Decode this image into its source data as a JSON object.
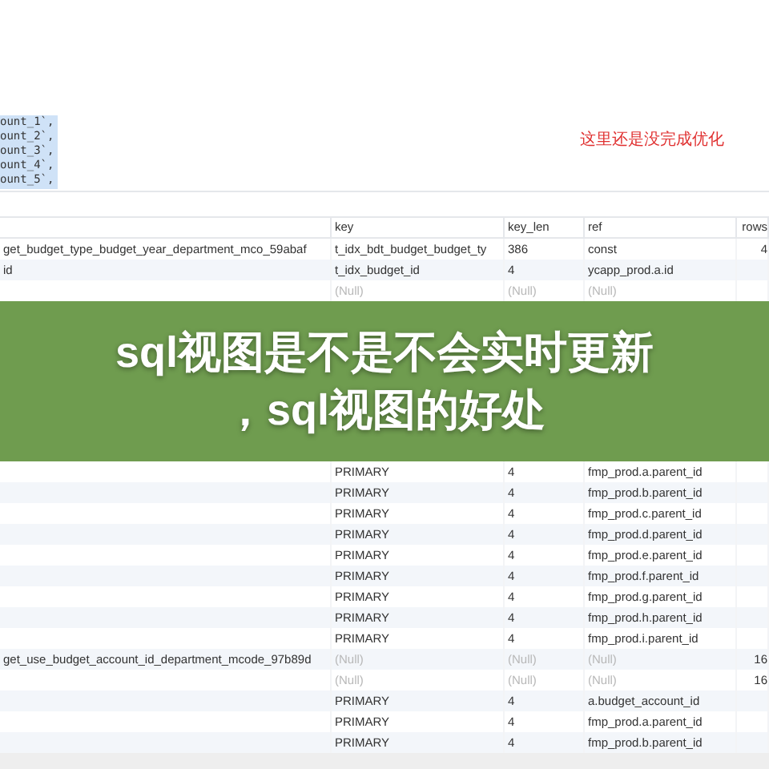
{
  "code_lines": [
    "ount_1`,",
    "ount_2`,",
    "ount_3`,",
    "ount_4`,",
    "ount_5`,"
  ],
  "annotation": "这里还是没完成优化",
  "table": {
    "columns": [
      "",
      "key",
      "key_len",
      "ref",
      "rows"
    ],
    "rows_top": [
      {
        "cells": [
          "get_budget_type_budget_year_department_mco_59abaf",
          "t_idx_bdt_budget_budget_ty",
          "386",
          "const",
          "4"
        ]
      },
      {
        "cells": [
          "id",
          "t_idx_budget_id",
          "4",
          "ycapp_prod.a.id",
          ""
        ]
      },
      {
        "cells": [
          "",
          "(Null)",
          "(Null)",
          "(Null)",
          ""
        ]
      }
    ],
    "rows_bottom": [
      {
        "cells": [
          "",
          "PRIMARY",
          "4",
          "fmp_prod.a.parent_id",
          ""
        ]
      },
      {
        "cells": [
          "",
          "PRIMARY",
          "4",
          "fmp_prod.b.parent_id",
          ""
        ]
      },
      {
        "cells": [
          "",
          "PRIMARY",
          "4",
          "fmp_prod.c.parent_id",
          ""
        ]
      },
      {
        "cells": [
          "",
          "PRIMARY",
          "4",
          "fmp_prod.d.parent_id",
          ""
        ]
      },
      {
        "cells": [
          "",
          "PRIMARY",
          "4",
          "fmp_prod.e.parent_id",
          ""
        ]
      },
      {
        "cells": [
          "",
          "PRIMARY",
          "4",
          "fmp_prod.f.parent_id",
          ""
        ]
      },
      {
        "cells": [
          "",
          "PRIMARY",
          "4",
          "fmp_prod.g.parent_id",
          ""
        ]
      },
      {
        "cells": [
          "",
          "PRIMARY",
          "4",
          "fmp_prod.h.parent_id",
          ""
        ]
      },
      {
        "cells": [
          "",
          "PRIMARY",
          "4",
          "fmp_prod.i.parent_id",
          ""
        ]
      },
      {
        "cells": [
          "get_use_budget_account_id_department_mcode_97b89d",
          "(Null)",
          "(Null)",
          "(Null)",
          "16"
        ]
      },
      {
        "cells": [
          "",
          "(Null)",
          "(Null)",
          "(Null)",
          "16"
        ]
      },
      {
        "cells": [
          "",
          "PRIMARY",
          "4",
          "a.budget_account_id",
          ""
        ]
      },
      {
        "cells": [
          "",
          "PRIMARY",
          "4",
          "fmp_prod.a.parent_id",
          ""
        ]
      },
      {
        "cells": [
          "",
          "PRIMARY",
          "4",
          "fmp_prod.b.parent_id",
          ""
        ]
      }
    ]
  },
  "banner": {
    "title_lines": [
      "sql视图是不是不会实时更新",
      "，sql视图的好处"
    ]
  }
}
